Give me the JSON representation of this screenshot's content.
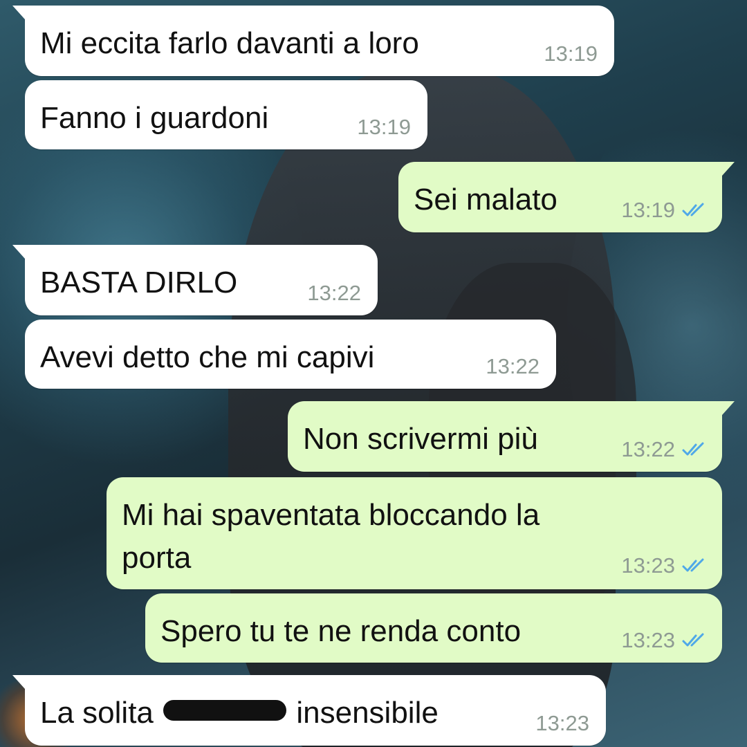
{
  "messages": [
    {
      "text": "Mi eccita farlo davanti a loro",
      "time": "13:19"
    },
    {
      "text": "Fanno i guardoni",
      "time": "13:19"
    },
    {
      "text": "Sei malato",
      "time": "13:19"
    },
    {
      "text": "BASTA DIRLO",
      "time": "13:22"
    },
    {
      "text": "Avevi detto che mi capivi",
      "time": "13:22"
    },
    {
      "text": "Non scrivermi più",
      "time": "13:22"
    },
    {
      "text": "Mi hai spaventata bloccando la",
      "text2": "porta",
      "time": "13:23"
    },
    {
      "text": "Spero tu te ne renda conto",
      "time": "13:23"
    },
    {
      "text_before": "La solita",
      "text_after": "insensibile",
      "time": "13:23"
    }
  ],
  "colors": {
    "incoming_bubble": "#ffffff",
    "outgoing_bubble": "#e1fbc6",
    "read_ticks": "#4fa8e8",
    "timestamp": "#8e9a93"
  },
  "icons": {
    "read_receipt": "double-check-icon",
    "redaction": "scribble-redaction"
  }
}
